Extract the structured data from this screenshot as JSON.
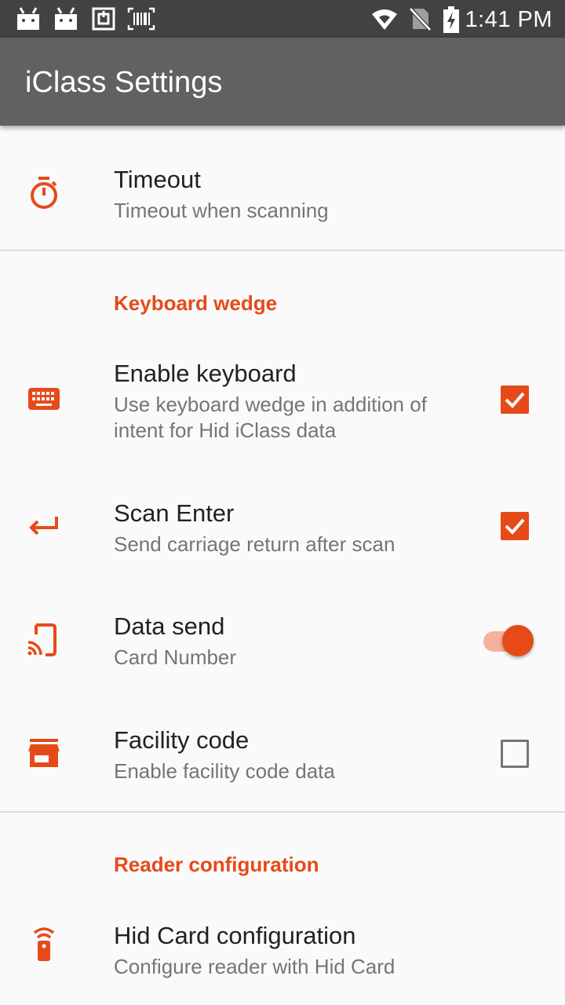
{
  "status_bar": {
    "time": "1:41 PM",
    "icons": [
      "android-icon",
      "android-icon",
      "nfc-icon",
      "barcode-icon",
      "wifi-icon",
      "no-sim-icon",
      "battery-charging-icon"
    ]
  },
  "app_bar": {
    "title": "iClass Settings"
  },
  "colors": {
    "accent": "#e64a19",
    "appbar": "#616161",
    "statusbar": "#424242"
  },
  "preferences": {
    "timeout": {
      "title": "Timeout",
      "summary": "Timeout when scanning",
      "icon": "timer-icon"
    },
    "keyboard_wedge": {
      "header": "Keyboard wedge",
      "enable_keyboard": {
        "title": "Enable keyboard",
        "summary": "Use keyboard wedge in addition of intent for Hid iClass data",
        "checked": true,
        "icon": "keyboard-icon"
      },
      "scan_enter": {
        "title": "Scan Enter",
        "summary": "Send carriage return after scan",
        "checked": true,
        "icon": "return-icon"
      },
      "data_send": {
        "title": "Data send",
        "summary": "Card Number",
        "switch_on": true,
        "icon": "cast-icon"
      },
      "facility_code": {
        "title": "Facility code",
        "summary": "Enable facility code data",
        "checked": false,
        "icon": "store-icon"
      }
    },
    "reader_configuration": {
      "header": "Reader configuration",
      "hid_card": {
        "title": "Hid Card configuration",
        "summary": "Configure reader with Hid Card",
        "icon": "remote-icon"
      }
    }
  }
}
